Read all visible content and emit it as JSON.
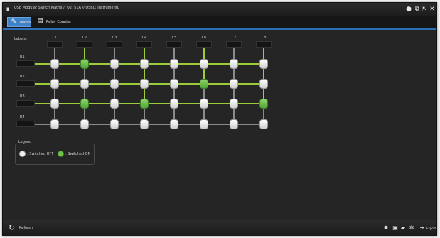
{
  "window": {
    "title": "USB Modular Switch Matrix // U2751A // USB0::Instrument0"
  },
  "tabs": [
    {
      "label": "Matrix",
      "icon": "wrench-icon",
      "active": true
    },
    {
      "label": "Relay Counter",
      "icon": "counter-icon",
      "active": false
    }
  ],
  "matrix": {
    "labels_heading": "Labels:",
    "columns": [
      "C1",
      "C2",
      "C3",
      "C4",
      "C5",
      "C6",
      "C7",
      "C8"
    ],
    "rows": [
      "R1",
      "R2",
      "R3",
      "R4"
    ],
    "switch_on": [
      [
        false,
        true,
        false,
        false,
        false,
        false,
        false,
        false
      ],
      [
        false,
        false,
        false,
        false,
        false,
        true,
        false,
        false
      ],
      [
        false,
        true,
        false,
        true,
        false,
        false,
        false,
        true
      ],
      [
        false,
        false,
        false,
        false,
        false,
        false,
        false,
        false
      ]
    ]
  },
  "legend": {
    "title": "Legend",
    "off_label": ": Switched OFF",
    "on_label": ": Switched ON"
  },
  "bottom": {
    "refresh_label": "Refresh",
    "export_label": "Export"
  },
  "colors": {
    "accent": "#3f82c8",
    "switch_on": "#6cc24a",
    "line_on": "#9ccc3a",
    "background": "#252525"
  }
}
